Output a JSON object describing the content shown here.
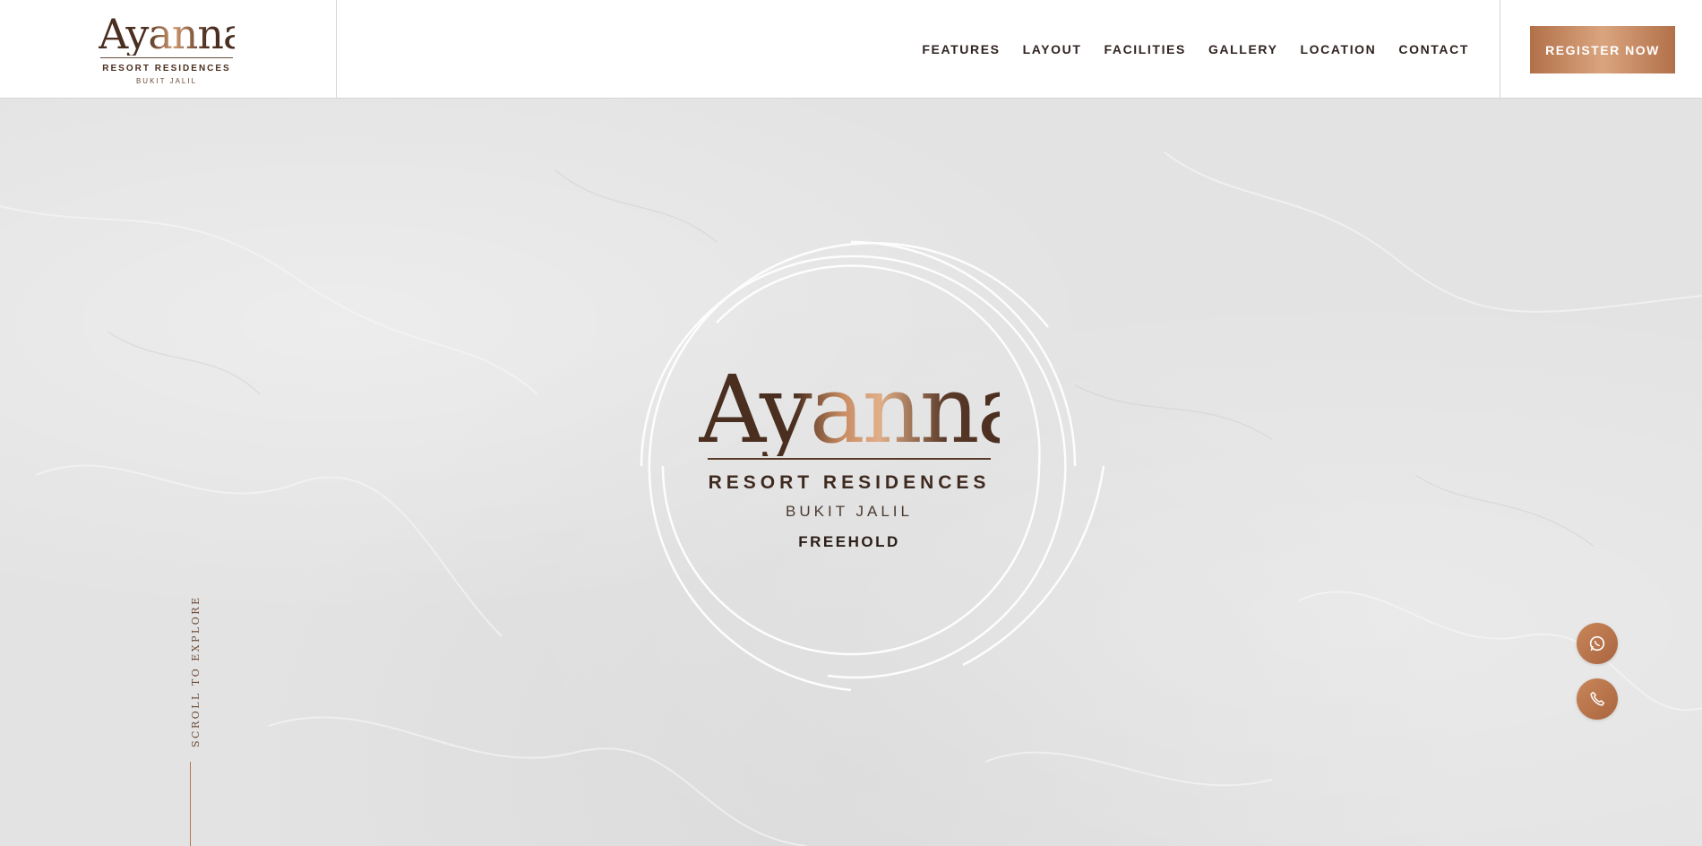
{
  "header": {
    "logo": {
      "script": "Ayanna",
      "line1": "RESORT RESIDENCES",
      "line2": "BUKIT JALIL"
    },
    "nav": [
      "FEATURES",
      "LAYOUT",
      "FACILITIES",
      "GALLERY",
      "LOCATION",
      "CONTACT"
    ],
    "cta_label": "REGISTER NOW"
  },
  "hero": {
    "emblem": {
      "script": "Ayanna",
      "line1": "RESORT RESIDENCES",
      "line2": "BUKIT JALIL",
      "line3": "FREEHOLD"
    },
    "scroll_label": "SCROLL TO EXPLORE"
  },
  "floating_buttons": {
    "whatsapp_icon": "whatsapp-icon",
    "phone_icon": "phone-icon"
  },
  "colors": {
    "accent": "#b27049",
    "dark_brown": "#4a2e1f",
    "background": "#e3e3e3"
  }
}
